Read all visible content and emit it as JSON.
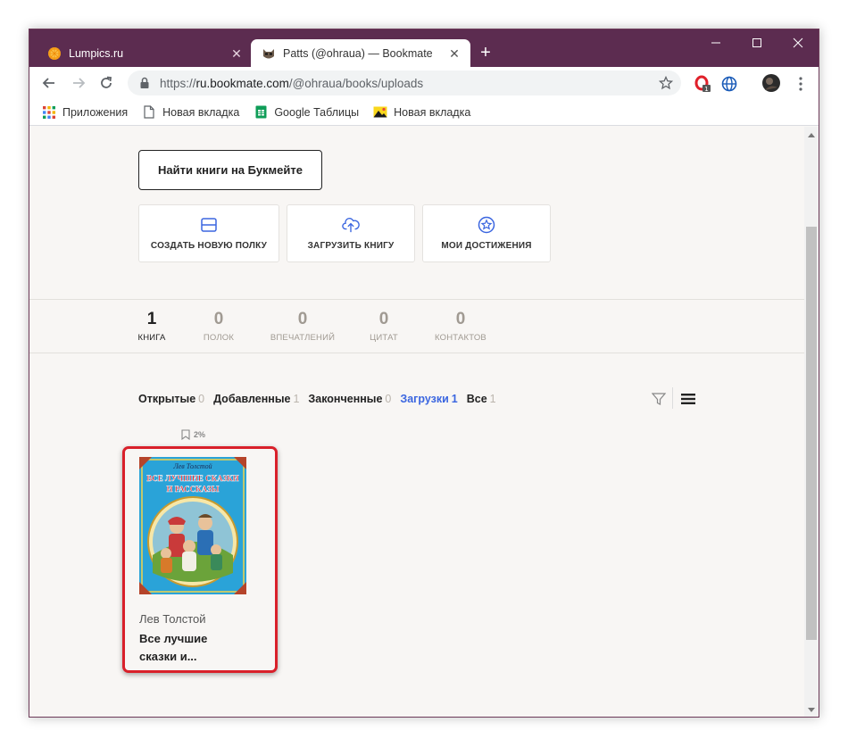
{
  "browser": {
    "tabs": [
      {
        "title": "Lumpics.ru",
        "favicon": "orange-circle-icon"
      },
      {
        "title": "Patts (@ohraua) — Bookmate",
        "favicon": "cat-avatar-icon"
      }
    ],
    "url_prefix": "https://",
    "url_host": "ru.bookmate.com",
    "url_path": "/@ohraua/books/uploads",
    "opera_badge": "1"
  },
  "bookmarks": [
    {
      "label": "Приложения",
      "icon": "apps-grid-icon"
    },
    {
      "label": "Новая вкладка",
      "icon": "page-icon"
    },
    {
      "label": "Google Таблицы",
      "icon": "sheets-icon"
    },
    {
      "label": "Новая вкладка",
      "icon": "image-icon"
    }
  ],
  "page": {
    "find_button": "Найти книги на Букмейте",
    "actions": [
      {
        "label": "Создать новую полку",
        "icon": "shelf-icon"
      },
      {
        "label": "Загрузить книгу",
        "icon": "upload-cloud-icon"
      },
      {
        "label": "Мои достижения",
        "icon": "star-badge-icon"
      }
    ],
    "stats": [
      {
        "num": "1",
        "label": "книга"
      },
      {
        "num": "0",
        "label": "полок"
      },
      {
        "num": "0",
        "label": "впечатлений"
      },
      {
        "num": "0",
        "label": "цитат"
      },
      {
        "num": "0",
        "label": "контактов"
      }
    ],
    "filters": [
      {
        "label": "Открытые",
        "count": "0"
      },
      {
        "label": "Добавленные",
        "count": "1"
      },
      {
        "label": "Законченные",
        "count": "0"
      },
      {
        "label": "Загрузки",
        "count": "1"
      },
      {
        "label": "Все",
        "count": "1"
      }
    ],
    "active_filter": "Загрузки",
    "book": {
      "progress": "2%",
      "cover_author": "Лев Толстой",
      "cover_title_line1": "ВСЕ ЛУЧШИЕ СКАЗКИ",
      "cover_title_line2": "И РАССКАЗЫ",
      "author": "Лев Толстой",
      "title_line1": "Все лучшие",
      "title_line2": "сказки и..."
    }
  },
  "colors": {
    "titlebar": "#5c2c50",
    "accent": "#3b66e0",
    "highlight": "#d9202a"
  }
}
